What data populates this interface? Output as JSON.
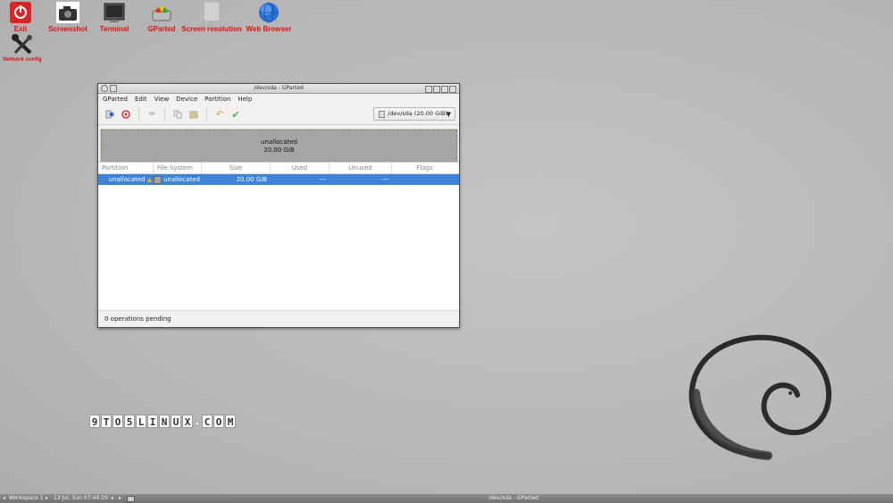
{
  "desktop_icons": [
    {
      "label": "Exit",
      "icon": "power-icon",
      "color": "#e02020"
    },
    {
      "label": "Screenshot",
      "icon": "camera-icon"
    },
    {
      "label": "Terminal",
      "icon": "terminal-icon"
    },
    {
      "label": "GParted",
      "icon": "gparted-icon"
    },
    {
      "label": "Screen resolution",
      "icon": "monitor-icon"
    },
    {
      "label": "Web Browser",
      "icon": "globe-icon"
    },
    {
      "label": "Network config",
      "icon": "wrench-icon"
    }
  ],
  "window": {
    "title": "/dev/sda - GParted",
    "menu": [
      "GParted",
      "Edit",
      "View",
      "Device",
      "Partition",
      "Help"
    ],
    "device_selector": "/dev/sda (20.00 GiB)",
    "graphic": {
      "label": "unallocated",
      "size": "20.00 GiB"
    },
    "columns": [
      "Partition",
      "File System",
      "Size",
      "Used",
      "Unused",
      "Flags"
    ],
    "rows": [
      {
        "partition": "unallocated",
        "filesystem": "unallocated",
        "size": "20.00 GiB",
        "used": "---",
        "unused": "---",
        "flags": ""
      }
    ],
    "status": "0 operations pending"
  },
  "watermark": "9TO5LINUX.COM",
  "taskbar": {
    "workspace": "Workspace 1",
    "clock": "13 Jul, Sun 07:44:20",
    "task": "/dev/sda - GParted"
  },
  "colors": {
    "selection": "#3c83d9",
    "icon_label": "#e01010"
  }
}
